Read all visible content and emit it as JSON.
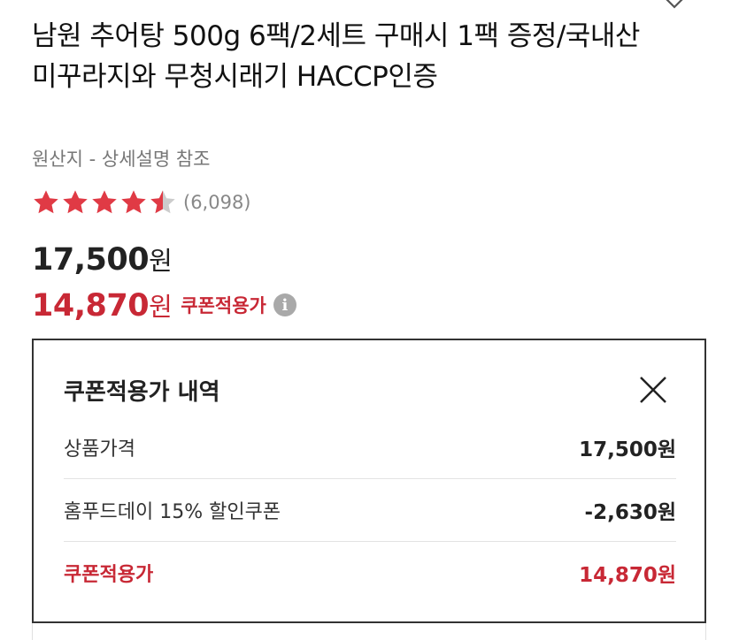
{
  "product": {
    "title": "남원 추어탕 500g 6팩/2세트 구매시 1팩 증정/국내산 미꾸라지와 무청시래기 HACCP인증",
    "origin": "원산지 - 상세설명 참조",
    "rating": 4.5,
    "rating_count": "(6,098)",
    "original_price": "17,500",
    "sale_price": "14,870",
    "currency": "원",
    "coupon_label": "쿠폰적용가",
    "info_icon": "i"
  },
  "popup": {
    "title": "쿠폰적용가 내역",
    "rows": [
      {
        "label": "상품가격",
        "value": "17,500원"
      },
      {
        "label": "홈푸드데이 15% 할인쿠폰",
        "value": "-2,630원"
      },
      {
        "label": "쿠폰적용가",
        "value": "14,870원"
      }
    ]
  },
  "colors": {
    "accent": "#c82835",
    "star": "#e03a45",
    "star_empty": "#cccccc"
  },
  "icons": {
    "wish": "heart-outline-icon",
    "close": "close-icon",
    "info": "info-icon",
    "star": "star-icon"
  }
}
